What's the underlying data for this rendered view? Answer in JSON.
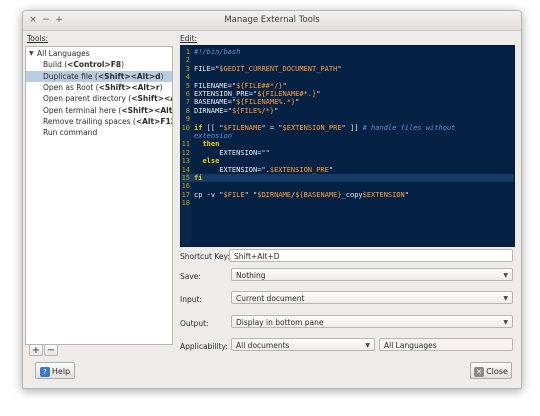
{
  "window": {
    "title": "Manage External Tools",
    "controls": {
      "close": "×",
      "minimize": "−",
      "maximize": "+"
    }
  },
  "tools_label": "Tools:",
  "edit_label": "Edit:",
  "tree": {
    "root": "All Languages",
    "items": [
      {
        "name": "Build",
        "shortcut": "<Control>F8"
      },
      {
        "name": "Duplicate file",
        "shortcut": "<Shift><Alt>d",
        "selected": true
      },
      {
        "name": "Open as Root",
        "shortcut": "<Shift><Alt>r"
      },
      {
        "name": "Open parent directory",
        "shortcut": "<Shift><Alt>"
      },
      {
        "name": "Open terminal here",
        "shortcut": "<Shift><Alt>t"
      },
      {
        "name": "Remove trailing spaces",
        "shortcut": "<Alt>F12"
      },
      {
        "name": "Run command",
        "shortcut": ""
      }
    ]
  },
  "tree_buttons": {
    "add": "+",
    "remove": "−"
  },
  "code_lines": [
    {
      "n": "1",
      "text": "#!/bin/bash"
    },
    {
      "n": "2",
      "text": ""
    },
    {
      "n": "3",
      "text": "FILE=\"$GEDIT_CURRENT_DOCUMENT_PATH\""
    },
    {
      "n": "4",
      "text": ""
    },
    {
      "n": "5",
      "text": "FILENAME=\"${FILE##*/}\""
    },
    {
      "n": "6",
      "text": "EXTENSION_PRE=\"${FILENAME#*.}\""
    },
    {
      "n": "7",
      "text": "BASENAME=\"${FILENAME%.*}\""
    },
    {
      "n": "8",
      "text": "DIRNAME=\"${FILE%/*}\""
    },
    {
      "n": "9",
      "text": ""
    },
    {
      "n": "10",
      "text": "if [[ \"$FILENAME\" = \"$EXTENSION_PRE\" ]] # handle files without"
    },
    {
      "n": "",
      "text": "extension"
    },
    {
      "n": "11",
      "text": "  then"
    },
    {
      "n": "12",
      "text": "      EXTENSION=\"\""
    },
    {
      "n": "13",
      "text": "  else"
    },
    {
      "n": "14",
      "text": "      EXTENSION=\".$EXTENSION_PRE\""
    },
    {
      "n": "15",
      "text": "fi"
    },
    {
      "n": "16",
      "text": ""
    },
    {
      "n": "17",
      "text": "cp -v \"$FILE\" \"$DIRNAME/${BASENAME}_copy$EXTENSION\""
    },
    {
      "n": "18",
      "text": ""
    }
  ],
  "form": {
    "shortcut_label": "Shortcut Key:",
    "shortcut_value": "Shift+Alt+D",
    "save_label": "Save:",
    "save_value": "Nothing",
    "input_label": "Input:",
    "input_value": "Current document",
    "output_label": "Output:",
    "output_value": "Display in bottom pane",
    "applicability_label": "Applicability:",
    "applicability_value": "All documents",
    "languages_value": "All Languages"
  },
  "buttons": {
    "help": "Help",
    "close": "Close"
  },
  "colors": {
    "editor_bg": "#052244",
    "selection": "#b8cde3",
    "keyword": "#f0d000",
    "variable": "#ff9d3a"
  }
}
